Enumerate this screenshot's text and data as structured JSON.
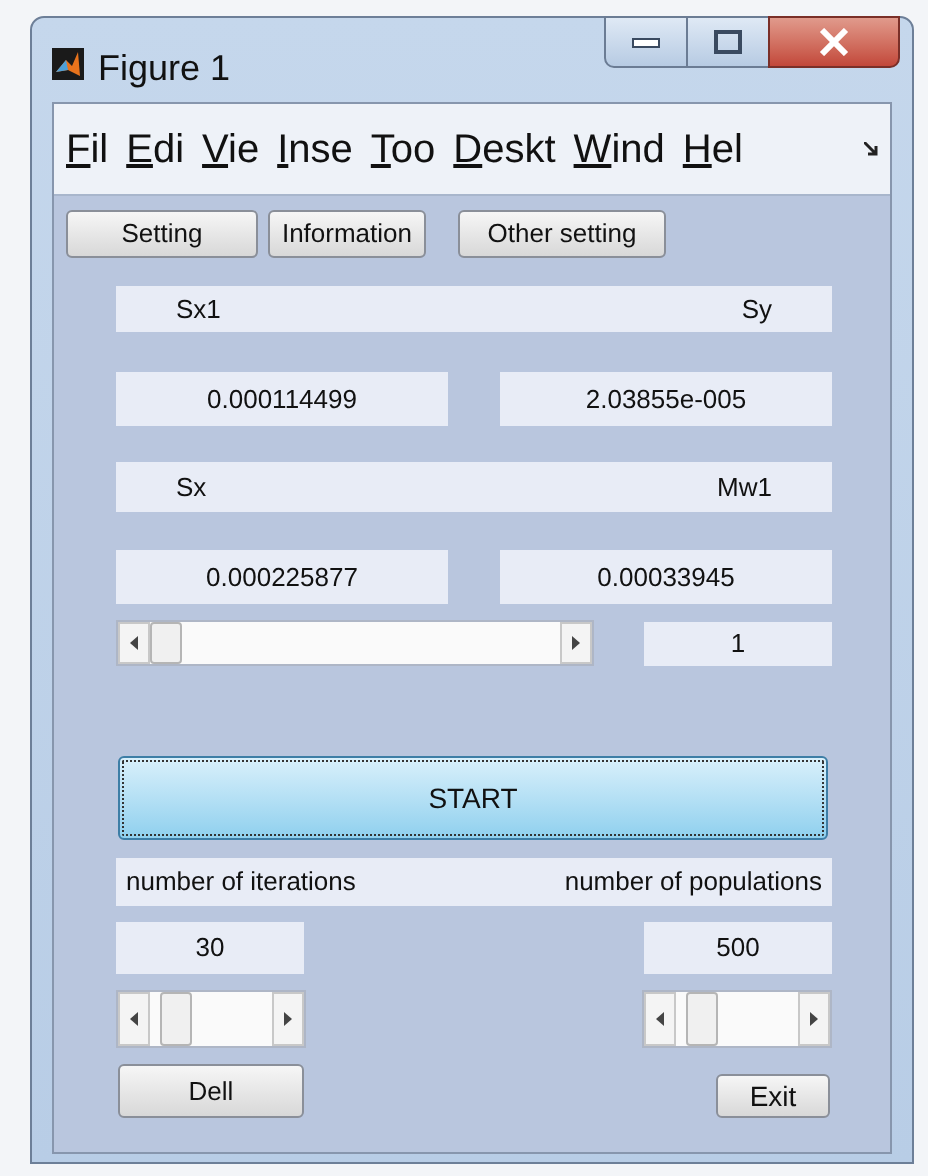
{
  "window": {
    "title": "Figure 1"
  },
  "menu": [
    {
      "label": "Fil"
    },
    {
      "label": "Edi"
    },
    {
      "label": "Vie"
    },
    {
      "label": "Inse"
    },
    {
      "label": "Too"
    },
    {
      "label": "Deskt"
    },
    {
      "label": "Wind"
    },
    {
      "label": "Hel"
    }
  ],
  "tabs": [
    {
      "label": "Setting"
    },
    {
      "label": "Information"
    },
    {
      "label": "Other setting"
    }
  ],
  "header_1": {
    "left": "Sx1",
    "right": "Sy"
  },
  "values_1": [
    "0.000114499",
    "2.03855e-005"
  ],
  "header_2": {
    "left": "Sx",
    "right": "Mw1"
  },
  "values_2": [
    "0.000225877",
    "0.00033945"
  ],
  "main_slider": {
    "level": 0
  },
  "slider_value": "1",
  "start_button": "START",
  "header_3": {
    "left": "number of iterations",
    "right": "number of populations"
  },
  "iterations": {
    "value": "30",
    "level": 0.1
  },
  "populations": {
    "value": "500",
    "level": 0.1
  },
  "buttons": {
    "left": "Dell",
    "right": "Exit"
  }
}
